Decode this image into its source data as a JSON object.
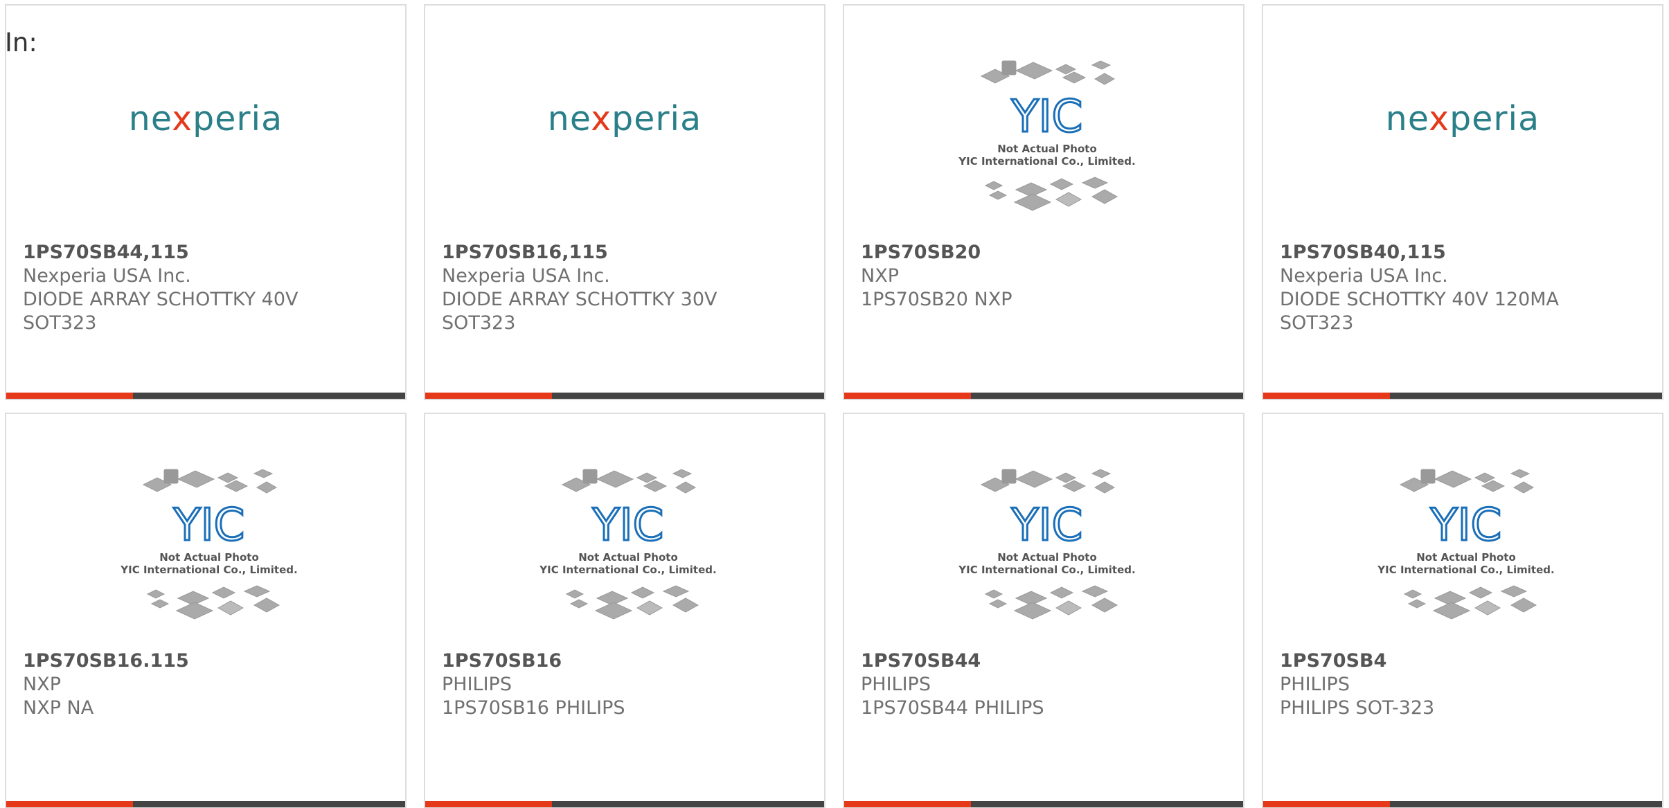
{
  "header": {
    "in_label": "In:"
  },
  "placeholder": {
    "line1": "Not Actual Photo",
    "line2": "YIC International Co., Limited.",
    "logo_text": "YIC"
  },
  "logo": {
    "pre": "ne",
    "x": "x",
    "post": "peria"
  },
  "colors": {
    "accent": "#e5391a",
    "bar": "#444444",
    "nexperia_teal": "#2a7f89",
    "yic_blue": "#1a6fb8"
  },
  "cards": [
    {
      "part": "1PS70SB44,115",
      "maker": "Nexperia USA Inc.",
      "desc": "DIODE ARRAY SCHOTTKY 40V",
      "desc2": "SOT323",
      "image": "nexperia-logo"
    },
    {
      "part": "1PS70SB16,115",
      "maker": "Nexperia USA Inc.",
      "desc": "DIODE ARRAY SCHOTTKY 30V",
      "desc2": "SOT323",
      "image": "nexperia-logo"
    },
    {
      "part": "1PS70SB20",
      "maker": "NXP",
      "desc": "1PS70SB20 NXP",
      "desc2": "",
      "image": "yic-placeholder"
    },
    {
      "part": "1PS70SB40,115",
      "maker": "Nexperia USA Inc.",
      "desc": "DIODE SCHOTTKY 40V 120MA",
      "desc2": "SOT323",
      "image": "nexperia-logo"
    },
    {
      "part": "1PS70SB16.115",
      "maker": "NXP",
      "desc": "NXP NA",
      "desc2": "",
      "image": "yic-placeholder"
    },
    {
      "part": "1PS70SB16",
      "maker": "PHILIPS",
      "desc": "1PS70SB16 PHILIPS",
      "desc2": "",
      "image": "yic-placeholder"
    },
    {
      "part": "1PS70SB44",
      "maker": "PHILIPS",
      "desc": "1PS70SB44 PHILIPS",
      "desc2": "",
      "image": "yic-placeholder"
    },
    {
      "part": "1PS70SB4",
      "maker": "PHILIPS",
      "desc": "PHILIPS SOT-323",
      "desc2": "",
      "image": "yic-placeholder"
    }
  ]
}
